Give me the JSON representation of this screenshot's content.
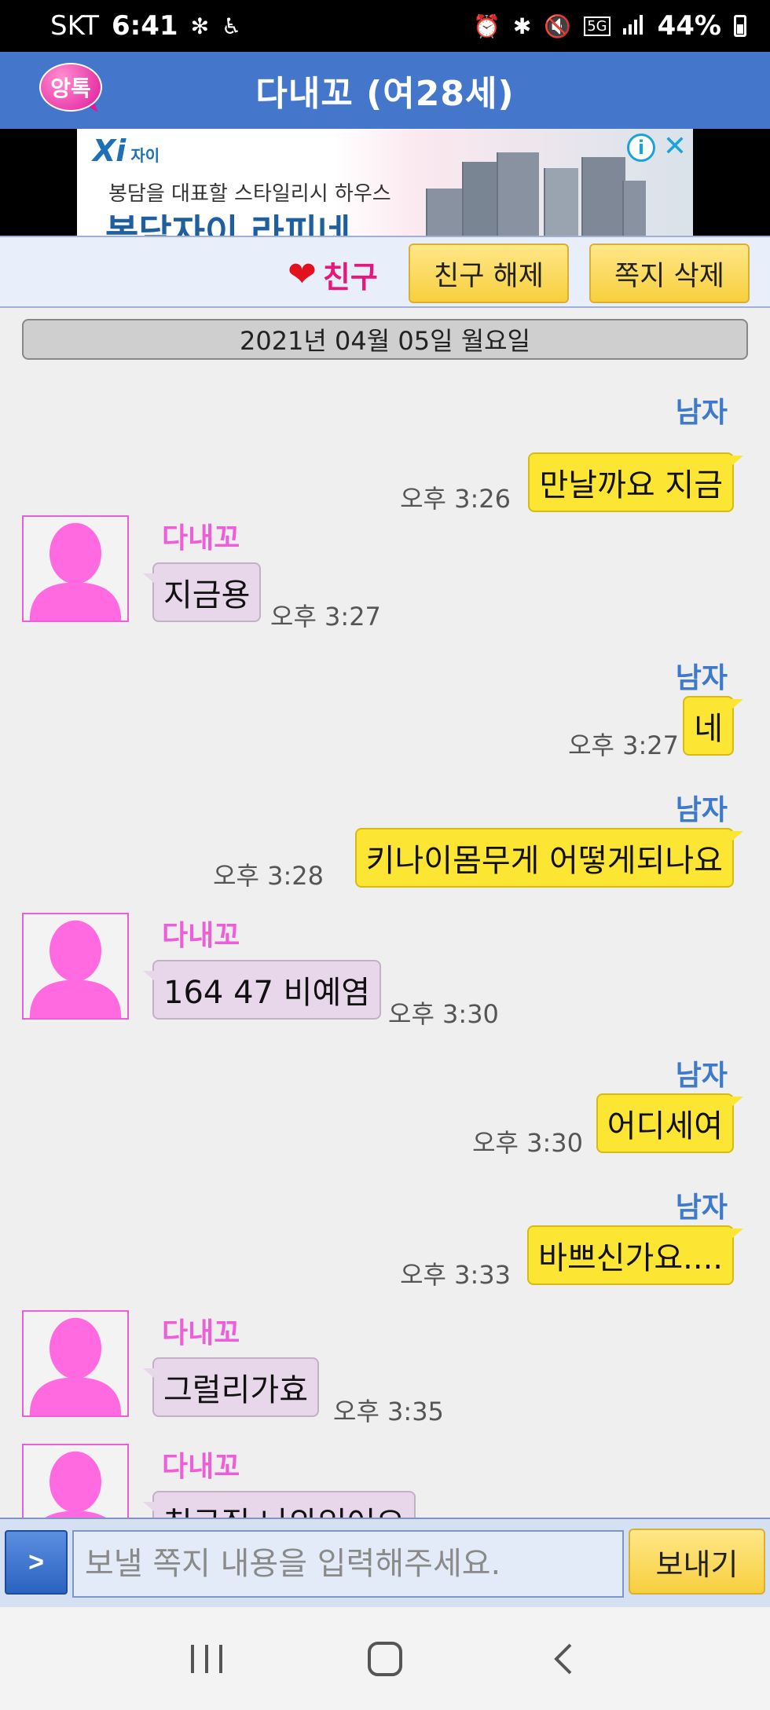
{
  "status_bar": {
    "carrier": "SKT",
    "time": "6:41",
    "network": "5G",
    "battery": "44%",
    "icons": [
      "fan-icon",
      "accessibility-icon",
      "alarm-icon",
      "bluetooth-icon",
      "mute-icon",
      "signal-icon",
      "battery-icon"
    ]
  },
  "header": {
    "logo_text": "앙톡",
    "title": "다내꼬 (여28세)"
  },
  "ad": {
    "brand": "Xi",
    "brand_sub": "자이",
    "tagline": "봉담을 대표할 스타일리시 하우스",
    "headline": "봉담자이 라피네",
    "info": "i",
    "close": "✕"
  },
  "actions": {
    "friend_label": "친구",
    "unfriend_label": "친구 해제",
    "delete_label": "쪽지 삭제"
  },
  "date": "2021년 04월 05일 월요일",
  "messages": [
    {
      "from": "me",
      "sender": "남자",
      "text": "만날까요 지금",
      "time": "오후 3:26"
    },
    {
      "from": "them",
      "sender": "다내꼬",
      "text": "지금용",
      "time": "오후 3:27"
    },
    {
      "from": "me",
      "sender": "남자",
      "text": "네",
      "time": "오후 3:27"
    },
    {
      "from": "me",
      "sender": "남자",
      "text": "키나이몸무게 어떻게되나요",
      "time": "오후 3:28"
    },
    {
      "from": "them",
      "sender": "다내꼬",
      "text": "164 47 비예염",
      "time": "오후 3:30"
    },
    {
      "from": "me",
      "sender": "남자",
      "text": "어디세여",
      "time": "오후 3:30"
    },
    {
      "from": "me",
      "sender": "남자",
      "text": "바쁘신가요....",
      "time": "오후 3:33"
    },
    {
      "from": "them",
      "sender": "다내꼬",
      "text": "그럴리가효",
      "time": "오후 3:35"
    },
    {
      "from": "them",
      "sender": "다내꼬",
      "text": "친구집 나와있어요",
      "time": ""
    }
  ],
  "composer": {
    "toggle_label": ">",
    "placeholder": "보낼 쪽지 내용을 입력해주세요.",
    "send_label": "보내기"
  },
  "colors": {
    "header": "#4477cc",
    "my_bubble": "#fde533",
    "their_bubble": "#e8d6ea",
    "male_name": "#3f79c9",
    "female_name": "#ef5ed9",
    "friend_red": "#e8157a"
  }
}
